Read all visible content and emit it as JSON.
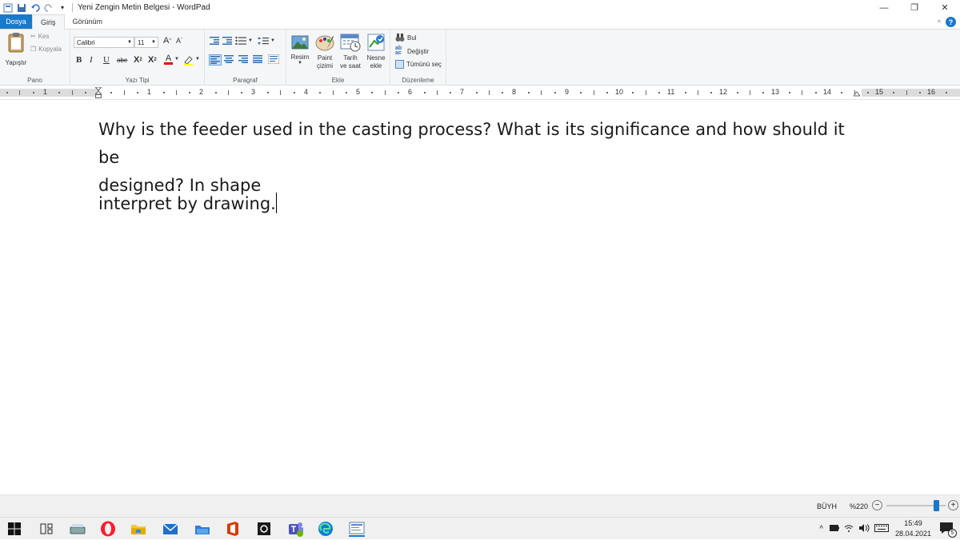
{
  "window": {
    "title": "Yeni Zengin Metin Belgesi - WordPad",
    "controls": {
      "minimize": "—",
      "restore": "❐",
      "close": "✕"
    }
  },
  "tabs": {
    "file": "Dosya",
    "home": "Giriş",
    "view": "Görünüm"
  },
  "ribbon": {
    "clipboard": {
      "paste": "Yapıştır",
      "cut": "Kes",
      "copy": "Kopyala",
      "group_label": "Pano"
    },
    "font": {
      "family": "Calibri",
      "size": "11",
      "grow": "A",
      "shrink": "A",
      "bold": "B",
      "italic": "I",
      "underline": "U",
      "strike": "abe",
      "subscript": "X",
      "superscript": "X",
      "color": "A",
      "group_label": "Yazı Tipi"
    },
    "paragraph": {
      "group_label": "Paragraf"
    },
    "insert": {
      "picture": "Resim",
      "paint1": "Paint",
      "paint2": "çizimi",
      "datetime1": "Tarih",
      "datetime2": "ve saat",
      "object1": "Nesne",
      "object2": "ekle",
      "group_label": "Ekle"
    },
    "editing": {
      "find": "Bul",
      "replace": "Değiştir",
      "select_all": "Tümünü seç",
      "group_label": "Düzenleme"
    }
  },
  "ruler": {
    "numbers": [
      "1",
      "1",
      "2",
      "3",
      "4",
      "5",
      "6",
      "7",
      "8",
      "9",
      "10",
      "11",
      "12",
      "13",
      "14",
      "15",
      "16"
    ]
  },
  "document": {
    "line1": "Why is the feeder used in the casting process? What is its significance and how should it be",
    "line2": "designed? In shape",
    "line3": "interpret by drawing."
  },
  "statusbar": {
    "caps": "BÜYH",
    "zoom": "%220",
    "zoom_level": 0.85,
    "zoom_out": "−",
    "zoom_in": "+"
  },
  "taskbar": {
    "time": "15:49",
    "date": "28.04.2021",
    "notifications": "5",
    "apps": [
      "windows-icon",
      "task-view-icon",
      "scanner-icon",
      "opera-icon",
      "file-explorer-icon",
      "mail-icon",
      "folder-blue-icon",
      "office-icon",
      "camera-icon",
      "teams-icon",
      "edge-icon",
      "wordpad-icon"
    ]
  },
  "colors": {
    "accent": "#1979ca",
    "ribbon_bg": "#f5f6f7",
    "office_red": "#d83b01",
    "opera_red": "#ff1b2d"
  }
}
